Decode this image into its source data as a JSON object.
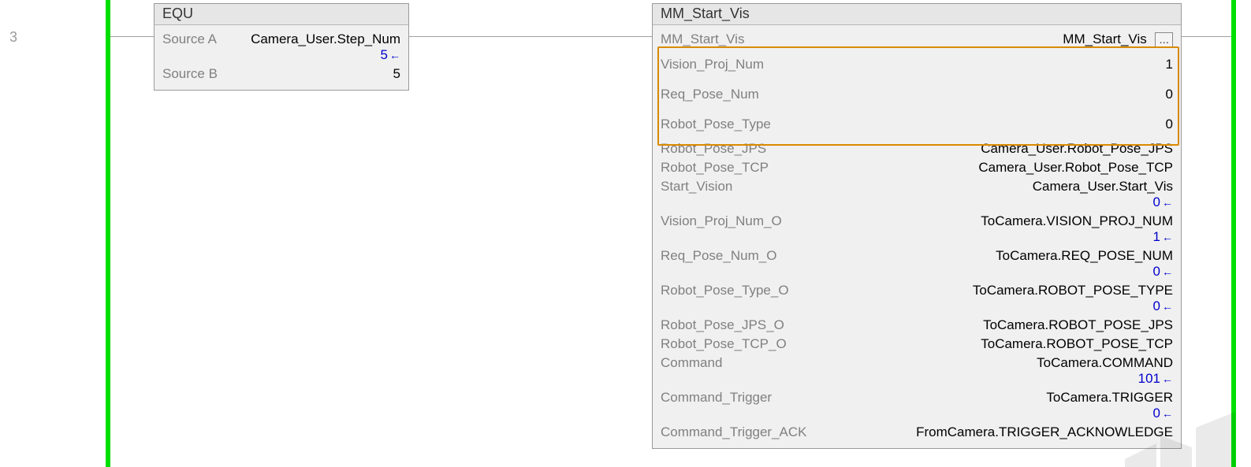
{
  "rung_number": "3",
  "equ_block": {
    "title": "EQU",
    "rows": [
      {
        "label": "Source A",
        "value": "Camera_User.Step_Num",
        "live": "5"
      },
      {
        "label": "Source B",
        "value": "5"
      }
    ]
  },
  "mmsv_block": {
    "title": "MM_Start_Vis",
    "header_row": {
      "label": "MM_Start_Vis",
      "value": "MM_Start_Vis",
      "more": "..."
    },
    "rows": [
      {
        "label": "Vision_Proj_Num",
        "value": "1",
        "highlighted": true
      },
      {
        "label": "Req_Pose_Num",
        "value": "0",
        "highlighted": true
      },
      {
        "label": "Robot_Pose_Type",
        "value": "0",
        "highlighted": true
      },
      {
        "label": "Robot_Pose_JPS",
        "value": "Camera_User.Robot_Pose_JPS"
      },
      {
        "label": "Robot_Pose_TCP",
        "value": "Camera_User.Robot_Pose_TCP"
      },
      {
        "label": "Start_Vision",
        "value": "Camera_User.Start_Vis",
        "live": "0"
      },
      {
        "label": "Vision_Proj_Num_O",
        "value": "ToCamera.VISION_PROJ_NUM",
        "live": "1"
      },
      {
        "label": "Req_Pose_Num_O",
        "value": "ToCamera.REQ_POSE_NUM",
        "live": "0"
      },
      {
        "label": "Robot_Pose_Type_O",
        "value": "ToCamera.ROBOT_POSE_TYPE",
        "live": "0"
      },
      {
        "label": "Robot_Pose_JPS_O",
        "value": "ToCamera.ROBOT_POSE_JPS"
      },
      {
        "label": "Robot_Pose_TCP_O",
        "value": "ToCamera.ROBOT_POSE_TCP"
      },
      {
        "label": "Command",
        "value": "ToCamera.COMMAND",
        "live": "101"
      },
      {
        "label": "Command_Trigger",
        "value": "ToCamera.TRIGGER",
        "live": "0"
      },
      {
        "label": "Command_Trigger_ACK",
        "value": "FromCamera.TRIGGER_ACKNOWLEDGE"
      }
    ]
  }
}
